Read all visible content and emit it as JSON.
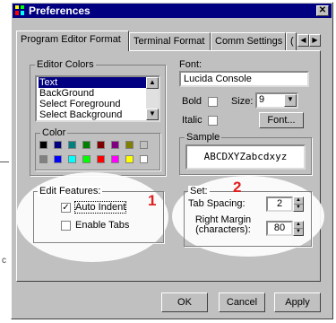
{
  "window": {
    "title": "Preferences",
    "close_glyph": "✕"
  },
  "tabs": [
    "Program Editor Format",
    "Terminal Format",
    "Comm Settings",
    "("
  ],
  "tab_scroll": {
    "left": "◀",
    "right": "▶"
  },
  "editor_colors": {
    "label": "Editor Colors",
    "items": [
      "Text",
      "BackGround",
      "Select Foreground",
      "Select Background"
    ],
    "selected_index": 0
  },
  "color": {
    "label": "Color",
    "swatches": [
      "#000000",
      "#000080",
      "#008080",
      "#008000",
      "#800000",
      "#800080",
      "#808000",
      "#c0c0c0",
      "#808080",
      "#0000ff",
      "#00ffff",
      "#00ff00",
      "#ff0000",
      "#ff00ff",
      "#ffff00",
      "#ffffff"
    ]
  },
  "font": {
    "label": "Font:",
    "value": "Lucida Console",
    "bold_label": "Bold",
    "size_label": "Size:",
    "size_value": "9",
    "italic_label": "Italic",
    "font_button": "Font..."
  },
  "sample": {
    "label": "Sample",
    "text": "ABCDXYZabcdxyz"
  },
  "edit_features": {
    "label": "Edit Features:",
    "auto_indent_label": "Auto Indent",
    "auto_indent_checked": true,
    "enable_tabs_label": "Enable Tabs",
    "enable_tabs_checked": false
  },
  "set": {
    "label": "Set:",
    "tab_spacing_label": "Tab Spacing:",
    "tab_spacing_value": "2",
    "right_margin_label_line1": "Right Margin",
    "right_margin_label_line2": "(characters):",
    "right_margin_value": "80"
  },
  "annotations": {
    "one": "1",
    "two": "2"
  },
  "buttons": {
    "ok": "OK",
    "cancel": "Cancel",
    "apply": "Apply"
  },
  "outside": {
    "stray_char": "c"
  },
  "colors": {
    "title_bar": "#000080",
    "dialog_face": "#c0c0c0",
    "annotation_red": "#e02020"
  }
}
